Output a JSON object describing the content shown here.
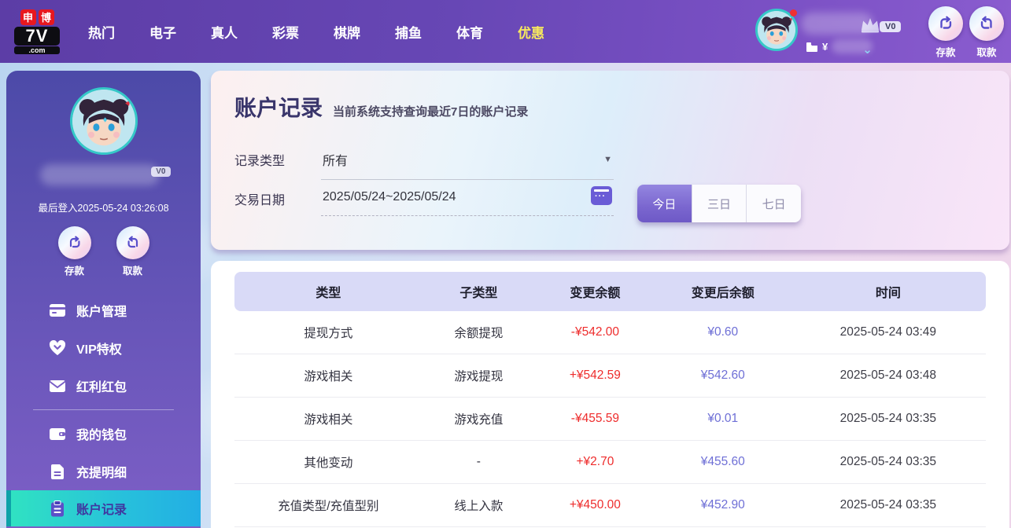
{
  "brand": {
    "char1": "申",
    "char2": "博",
    "line2": "7V",
    "line3": ".com"
  },
  "navbar": {
    "items": [
      {
        "label": "热门"
      },
      {
        "label": "电子"
      },
      {
        "label": "真人"
      },
      {
        "label": "彩票"
      },
      {
        "label": "棋牌"
      },
      {
        "label": "捕鱼"
      },
      {
        "label": "体育"
      },
      {
        "label": "优惠",
        "highlight": true
      }
    ],
    "vip_badge": "V0",
    "currency_symbol": "¥",
    "deposit_label": "存款",
    "withdraw_label": "取款"
  },
  "sidebar": {
    "vip_badge": "V0",
    "last_login": "最后登入2025-05-24 03:26:08",
    "deposit_label": "存款",
    "withdraw_label": "取款",
    "menu_top": [
      {
        "label": "账户管理",
        "icon": "card-icon"
      },
      {
        "label": "VIP特权",
        "icon": "vip-icon"
      },
      {
        "label": "红利红包",
        "icon": "envelope-icon"
      }
    ],
    "menu_bottom": [
      {
        "label": "我的钱包",
        "icon": "wallet-icon"
      },
      {
        "label": "充提明细",
        "icon": "document-icon"
      },
      {
        "label": "账户记录",
        "icon": "clipboard-icon",
        "active": true
      }
    ]
  },
  "main": {
    "title": "账户记录",
    "subtitle": "当前系统支持查询最近7日的账户记录",
    "filters": {
      "record_type_label": "记录类型",
      "record_type_value": "所有",
      "date_label": "交易日期",
      "date_value": "2025/05/24~2025/05/24",
      "range_buttons": [
        {
          "label": "今日",
          "active": true
        },
        {
          "label": "三日",
          "active": false
        },
        {
          "label": "七日",
          "active": false
        }
      ]
    },
    "table": {
      "columns": [
        "类型",
        "子类型",
        "变更余额",
        "变更后余额",
        "时间"
      ],
      "rows": [
        {
          "type": "提现方式",
          "subtype": "余额提现",
          "change": "-¥542.00",
          "balance": "¥0.60",
          "time": "2025-05-24 03:49"
        },
        {
          "type": "游戏相关",
          "subtype": "游戏提现",
          "change": "+¥542.59",
          "balance": "¥542.60",
          "time": "2025-05-24 03:48"
        },
        {
          "type": "游戏相关",
          "subtype": "游戏充值",
          "change": "-¥455.59",
          "balance": "¥0.01",
          "time": "2025-05-24 03:35"
        },
        {
          "type": "其他变动",
          "subtype": "-",
          "change": "+¥2.70",
          "balance": "¥455.60",
          "time": "2025-05-24 03:35"
        },
        {
          "type": "充值类型/充值型别",
          "subtype": "线上入款",
          "change": "+¥450.00",
          "balance": "¥452.90",
          "time": "2025-05-24 03:35"
        }
      ]
    }
  },
  "colors": {
    "navbar_gradient_start": "#5c3da6",
    "navbar_gradient_end": "#8a5ccf",
    "nav_highlight": "#f7e95e",
    "sidebar_active_teal_start": "#30e2c2",
    "sidebar_active_teal_end": "#22aee4",
    "change_amount": "#ee2c2c",
    "balance_amount": "#6e6fd6",
    "table_header_bg": "#d9daf7",
    "accent_purple": "#6a5cd6"
  }
}
